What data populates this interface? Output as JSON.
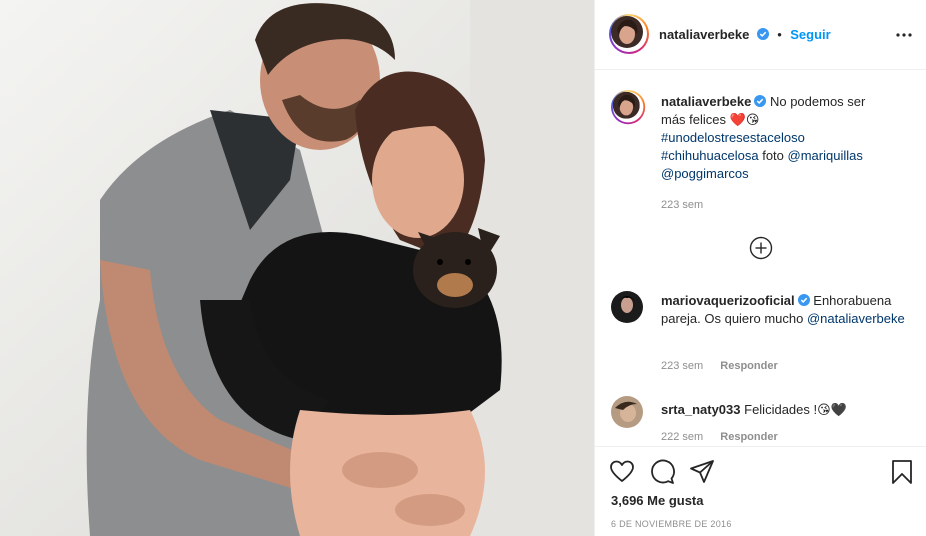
{
  "header": {
    "username": "nataliaverbeke",
    "separator": "•",
    "follow_label": "Seguir"
  },
  "caption": {
    "username": "nataliaverbeke",
    "text_line1": "No podemos ser",
    "text_line2": "más felices ❤️😘",
    "hashtag1": "#unodelostresestaceloso",
    "hashtag2": "#chihuhuacelosa",
    "mid_text": "foto",
    "mention1": "@mariquillas",
    "mention2": "@poggimarcos",
    "time": "223 sem"
  },
  "comments": [
    {
      "username": "mariovaquerizooficial",
      "text": "Enhorabuena pareja. Os quiero mucho",
      "mention": "@nataliaverbeke",
      "time": "223 sem",
      "reply_label": "Responder"
    },
    {
      "username": "srta_naty033",
      "text": "Felicidades !😘🖤",
      "time": "222 sem",
      "reply_label": "Responder"
    }
  ],
  "actions": {
    "likes": "3,696 Me gusta",
    "date": "6 DE NOVIEMBRE DE 2016"
  },
  "icons": {
    "verified": "verified-badge-icon",
    "more": "more-options-icon",
    "load_more": "plus-circle-icon",
    "like": "heart-icon",
    "comment": "comment-icon",
    "share": "send-icon",
    "save": "bookmark-icon"
  },
  "colors": {
    "link": "#00376b",
    "follow": "#0095f6",
    "verified": "#3897f0",
    "muted": "#8e8e8e"
  }
}
